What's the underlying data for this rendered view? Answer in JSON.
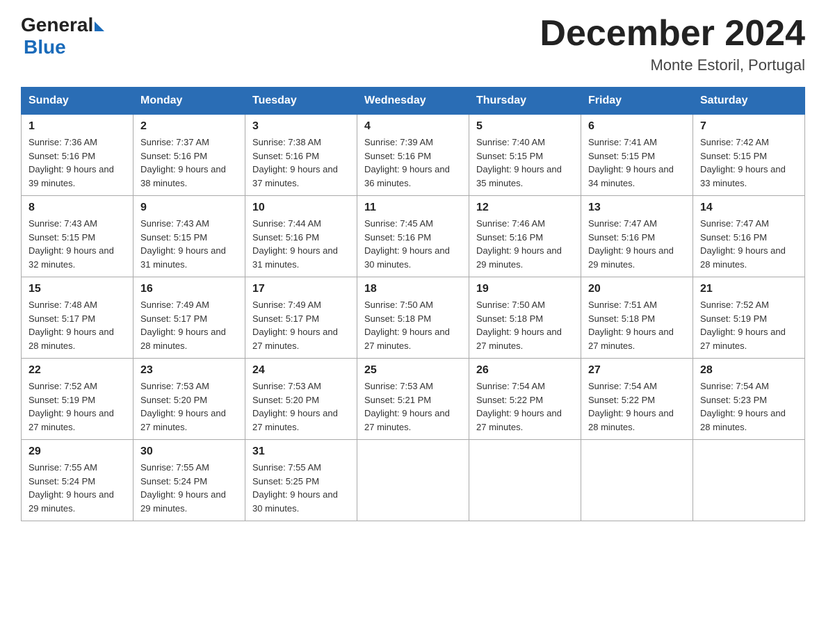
{
  "header": {
    "logo_general": "General",
    "logo_blue": "Blue",
    "month_title": "December 2024",
    "location": "Monte Estoril, Portugal"
  },
  "days_of_week": [
    "Sunday",
    "Monday",
    "Tuesday",
    "Wednesday",
    "Thursday",
    "Friday",
    "Saturday"
  ],
  "weeks": [
    [
      {
        "num": "1",
        "sunrise": "7:36 AM",
        "sunset": "5:16 PM",
        "daylight": "9 hours and 39 minutes."
      },
      {
        "num": "2",
        "sunrise": "7:37 AM",
        "sunset": "5:16 PM",
        "daylight": "9 hours and 38 minutes."
      },
      {
        "num": "3",
        "sunrise": "7:38 AM",
        "sunset": "5:16 PM",
        "daylight": "9 hours and 37 minutes."
      },
      {
        "num": "4",
        "sunrise": "7:39 AM",
        "sunset": "5:16 PM",
        "daylight": "9 hours and 36 minutes."
      },
      {
        "num": "5",
        "sunrise": "7:40 AM",
        "sunset": "5:15 PM",
        "daylight": "9 hours and 35 minutes."
      },
      {
        "num": "6",
        "sunrise": "7:41 AM",
        "sunset": "5:15 PM",
        "daylight": "9 hours and 34 minutes."
      },
      {
        "num": "7",
        "sunrise": "7:42 AM",
        "sunset": "5:15 PM",
        "daylight": "9 hours and 33 minutes."
      }
    ],
    [
      {
        "num": "8",
        "sunrise": "7:43 AM",
        "sunset": "5:15 PM",
        "daylight": "9 hours and 32 minutes."
      },
      {
        "num": "9",
        "sunrise": "7:43 AM",
        "sunset": "5:15 PM",
        "daylight": "9 hours and 31 minutes."
      },
      {
        "num": "10",
        "sunrise": "7:44 AM",
        "sunset": "5:16 PM",
        "daylight": "9 hours and 31 minutes."
      },
      {
        "num": "11",
        "sunrise": "7:45 AM",
        "sunset": "5:16 PM",
        "daylight": "9 hours and 30 minutes."
      },
      {
        "num": "12",
        "sunrise": "7:46 AM",
        "sunset": "5:16 PM",
        "daylight": "9 hours and 29 minutes."
      },
      {
        "num": "13",
        "sunrise": "7:47 AM",
        "sunset": "5:16 PM",
        "daylight": "9 hours and 29 minutes."
      },
      {
        "num": "14",
        "sunrise": "7:47 AM",
        "sunset": "5:16 PM",
        "daylight": "9 hours and 28 minutes."
      }
    ],
    [
      {
        "num": "15",
        "sunrise": "7:48 AM",
        "sunset": "5:17 PM",
        "daylight": "9 hours and 28 minutes."
      },
      {
        "num": "16",
        "sunrise": "7:49 AM",
        "sunset": "5:17 PM",
        "daylight": "9 hours and 28 minutes."
      },
      {
        "num": "17",
        "sunrise": "7:49 AM",
        "sunset": "5:17 PM",
        "daylight": "9 hours and 27 minutes."
      },
      {
        "num": "18",
        "sunrise": "7:50 AM",
        "sunset": "5:18 PM",
        "daylight": "9 hours and 27 minutes."
      },
      {
        "num": "19",
        "sunrise": "7:50 AM",
        "sunset": "5:18 PM",
        "daylight": "9 hours and 27 minutes."
      },
      {
        "num": "20",
        "sunrise": "7:51 AM",
        "sunset": "5:18 PM",
        "daylight": "9 hours and 27 minutes."
      },
      {
        "num": "21",
        "sunrise": "7:52 AM",
        "sunset": "5:19 PM",
        "daylight": "9 hours and 27 minutes."
      }
    ],
    [
      {
        "num": "22",
        "sunrise": "7:52 AM",
        "sunset": "5:19 PM",
        "daylight": "9 hours and 27 minutes."
      },
      {
        "num": "23",
        "sunrise": "7:53 AM",
        "sunset": "5:20 PM",
        "daylight": "9 hours and 27 minutes."
      },
      {
        "num": "24",
        "sunrise": "7:53 AM",
        "sunset": "5:20 PM",
        "daylight": "9 hours and 27 minutes."
      },
      {
        "num": "25",
        "sunrise": "7:53 AM",
        "sunset": "5:21 PM",
        "daylight": "9 hours and 27 minutes."
      },
      {
        "num": "26",
        "sunrise": "7:54 AM",
        "sunset": "5:22 PM",
        "daylight": "9 hours and 27 minutes."
      },
      {
        "num": "27",
        "sunrise": "7:54 AM",
        "sunset": "5:22 PM",
        "daylight": "9 hours and 28 minutes."
      },
      {
        "num": "28",
        "sunrise": "7:54 AM",
        "sunset": "5:23 PM",
        "daylight": "9 hours and 28 minutes."
      }
    ],
    [
      {
        "num": "29",
        "sunrise": "7:55 AM",
        "sunset": "5:24 PM",
        "daylight": "9 hours and 29 minutes."
      },
      {
        "num": "30",
        "sunrise": "7:55 AM",
        "sunset": "5:24 PM",
        "daylight": "9 hours and 29 minutes."
      },
      {
        "num": "31",
        "sunrise": "7:55 AM",
        "sunset": "5:25 PM",
        "daylight": "9 hours and 30 minutes."
      },
      null,
      null,
      null,
      null
    ]
  ]
}
